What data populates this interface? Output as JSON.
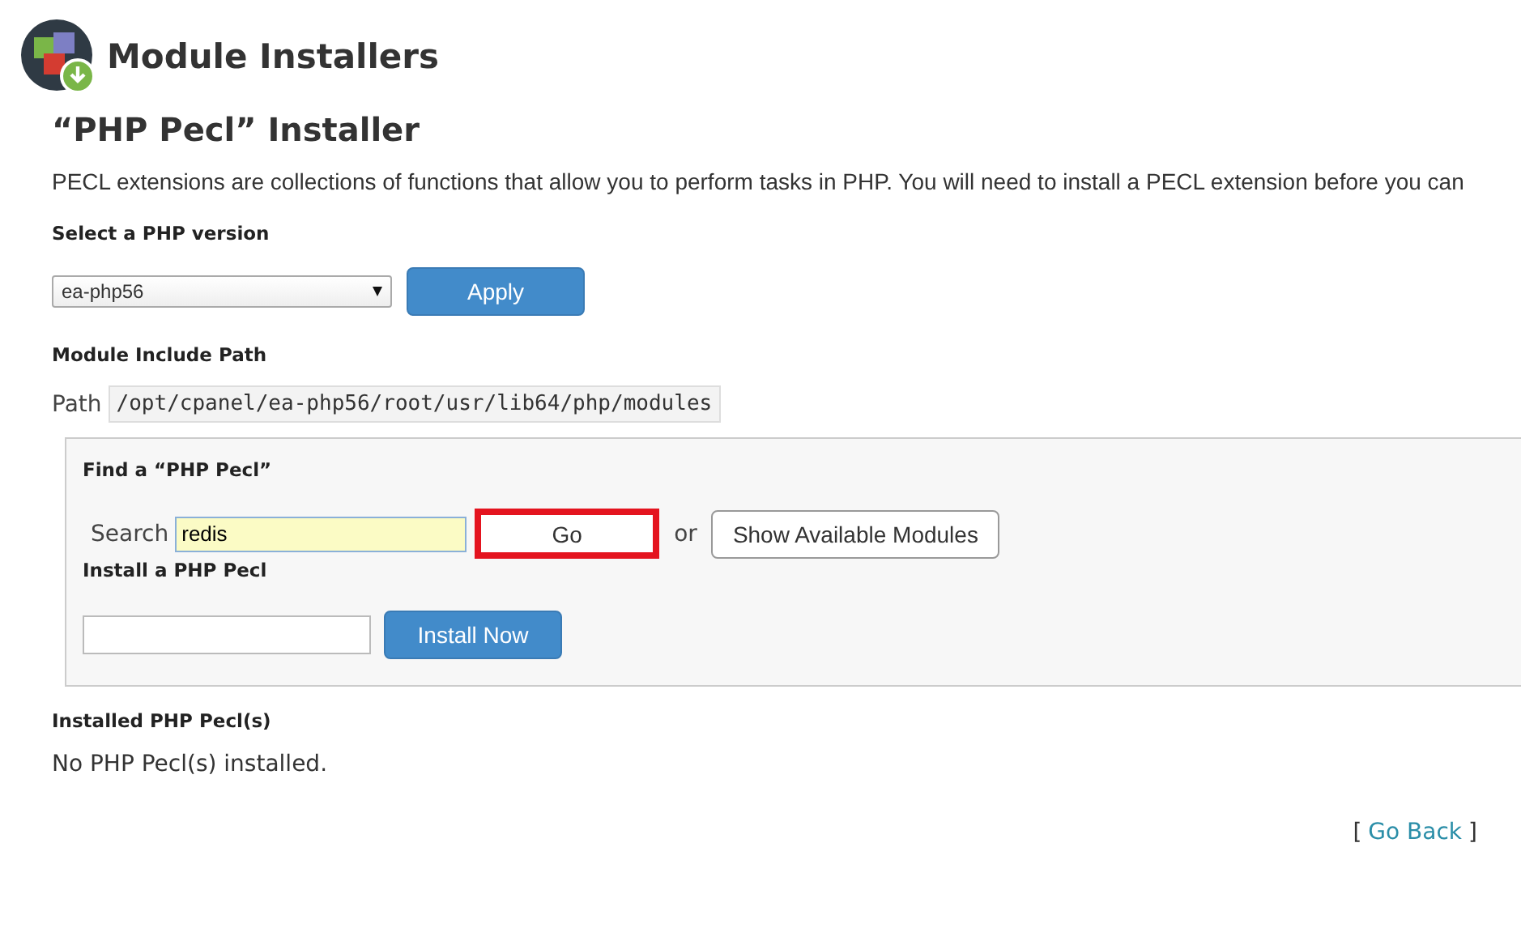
{
  "header": {
    "title": "Module Installers"
  },
  "page_title": "“PHP Pecl” Installer",
  "description": "PECL extensions are collections of functions that allow you to perform tasks in PHP. You will need to install a PECL extension before you can",
  "version": {
    "label": "Select a PHP version",
    "value": "ea-php56",
    "button": "Apply"
  },
  "include_path": {
    "heading": "Module Include Path",
    "label": "Path",
    "value": "/opt/cpanel/ea-php56/root/usr/lib64/php/modules"
  },
  "find": {
    "heading": "Find a “PHP Pecl”",
    "label": "Search",
    "value": "redis",
    "go": {
      "label": "Go",
      "highlighted": true
    },
    "or": "or",
    "show": "Show Available Modules"
  },
  "install": {
    "heading": "Install a PHP Pecl",
    "button": "Install Now"
  },
  "installed": {
    "heading": "Installed PHP Pecl(s)",
    "message": "No PHP Pecl(s) installed."
  },
  "go_back": {
    "open": "[",
    "label": "Go Back",
    "close": "]"
  }
}
